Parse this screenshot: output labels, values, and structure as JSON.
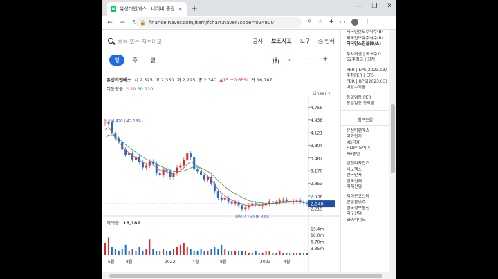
{
  "browser": {
    "tab_title": "유성티엔에스 : 네이버 증권",
    "url": "finance.naver.com/item/fchart.naver?code=024800",
    "new_tab": "+",
    "controls": [
      "—",
      "❐",
      "✕"
    ]
  },
  "toolbar": {
    "search_placeholder": "종목 또는 지수비교",
    "menu": [
      "공시",
      "보조지표",
      "도구",
      "인쇄"
    ]
  },
  "periods": [
    "일",
    "주",
    "월"
  ],
  "stock": {
    "name": "유성티엔에스",
    "open_label": "시",
    "open": "2,325",
    "high_label": "고",
    "high": "2,350",
    "low_label": "저",
    "low": "2,295",
    "close_label": "종",
    "close": "2,340",
    "change": "▲15",
    "change_pct": "+0.65%",
    "volume_label": "거",
    "volume": "16,187"
  },
  "ma": {
    "label": "이동평균",
    "p5": "5",
    "p20": "20",
    "p60": "60",
    "p120": "120"
  },
  "linear_label": "Linear ▾",
  "volume_panel": {
    "label": "거래량",
    "value": "16,187"
  },
  "annotations": {
    "high": "최고 4,420 (-47.18%)",
    "low": "최저 2,160 (8.33%)"
  },
  "chart_data": {
    "type": "line",
    "price_ticks": [
      "4,755",
      "4,438",
      "4,121",
      "3,804",
      "3,487",
      "3,170",
      "2,853",
      "2,536",
      "2,219"
    ],
    "price_tick_values": [
      4755,
      4438,
      4121,
      3804,
      3487,
      3170,
      2853,
      2536,
      2219
    ],
    "current_price": "2,340",
    "volume_ticks": [
      "13.4m",
      "10.0m",
      "6.70m",
      "3.35m"
    ],
    "x_labels": [
      "6월",
      "8월",
      "2022",
      "4월",
      "8월",
      "2023",
      "4월"
    ],
    "ylim": [
      2100,
      4900
    ],
    "series": [
      {
        "values": [
          4350,
          4380,
          4100,
          3980,
          3900,
          3700,
          3560,
          3600,
          3450,
          3520,
          3380,
          3250,
          3300,
          3400,
          3350,
          3100,
          3050,
          3200,
          3150,
          3000,
          3100,
          3250,
          3300,
          3450,
          3600,
          3500,
          3200,
          3150,
          3050,
          2950,
          3000,
          2850,
          2650,
          2500,
          2450,
          2480,
          2400,
          2350,
          2380,
          2300,
          2200,
          2250,
          2300,
          2350,
          2320,
          2280,
          2300,
          2350,
          2400,
          2370,
          2380,
          2420,
          2450,
          2410,
          2380,
          2400,
          2420,
          2390,
          2360,
          2340
        ]
      },
      {
        "values": [
          4200,
          4250,
          4150,
          4000,
          3900,
          3780,
          3680,
          3620,
          3550,
          3500,
          3430,
          3380,
          3340,
          3340,
          3330,
          3240,
          3180,
          3160,
          3140,
          3100,
          3090,
          3130,
          3170,
          3240,
          3330,
          3390,
          3350,
          3290,
          3200,
          3100,
          3030,
          2950,
          2820,
          2700,
          2600,
          2540,
          2480,
          2430,
          2400,
          2370,
          2330,
          2300,
          2290,
          2300,
          2310,
          2310,
          2310,
          2320,
          2340,
          2350,
          2360,
          2380,
          2400,
          2410,
          2400,
          2400,
          2400,
          2400,
          2390,
          2380
        ]
      },
      {
        "values": [
          4000,
          4050,
          4060,
          4030,
          3980,
          3900,
          3820,
          3750,
          3690,
          3630,
          3570,
          3510,
          3460,
          3420,
          3390,
          3340,
          3290,
          3250,
          3220,
          3180,
          3150,
          3140,
          3150,
          3170,
          3200,
          3240,
          3260,
          3260,
          3240,
          3200,
          3150,
          3090,
          3010,
          2920,
          2840,
          2770,
          2700,
          2640,
          2590,
          2550,
          2500,
          2460,
          2420,
          2400,
          2380,
          2370,
          2360,
          2350,
          2350,
          2350,
          2350,
          2360,
          2370,
          2380,
          2380,
          2390,
          2390,
          2390,
          2380,
          2380
        ]
      }
    ],
    "volume": [
      6,
      9,
      4,
      3,
      2,
      3,
      5,
      2,
      3,
      2,
      4,
      2,
      3,
      8,
      3,
      2,
      2,
      3,
      2,
      2,
      3,
      4,
      5,
      6,
      4,
      3,
      2,
      2,
      3,
      2,
      2,
      3,
      4,
      3,
      5,
      3,
      2,
      2,
      2,
      2,
      2,
      2,
      1,
      1,
      2,
      1,
      1,
      2,
      2,
      1,
      1,
      2,
      1,
      1,
      1,
      1,
      1,
      1,
      1,
      1
    ]
  },
  "sidebar": {
    "top_lines": [
      "외국인한도주식수(B)",
      "외국인보유주식수(B)",
      "외국인소진율(B/A)",
      "투자의견 | 목표주가",
      "52주최고 | 최저",
      "PER | EPS(2023.03)",
      "추정PER | EPS",
      "PBR | BPS(2023.03)",
      "배당수익률",
      "동일업종 PER",
      "동일업종 등락률"
    ],
    "recent_title": "최근조회",
    "recent": [
      "유성티엔에스",
      "이화전기",
      "KB금융",
      "HLB이노베이",
      "PN풍년",
      "삼천리자전거",
      "시노펙스",
      "한국단자",
      "한국선재",
      "미래산업",
      "제이준코스메",
      "한솔홀딩스",
      "한국정보통신",
      "이구산업",
      "SPA바이오"
    ]
  },
  "colors": {
    "accent": "#1e6be3",
    "up": "#e0262a",
    "down": "#1a6dd6",
    "ma5": "#e8a33c",
    "ma20": "#e04a4a",
    "ma60": "#2f9a4a",
    "ma120": "#7a4bc2"
  }
}
